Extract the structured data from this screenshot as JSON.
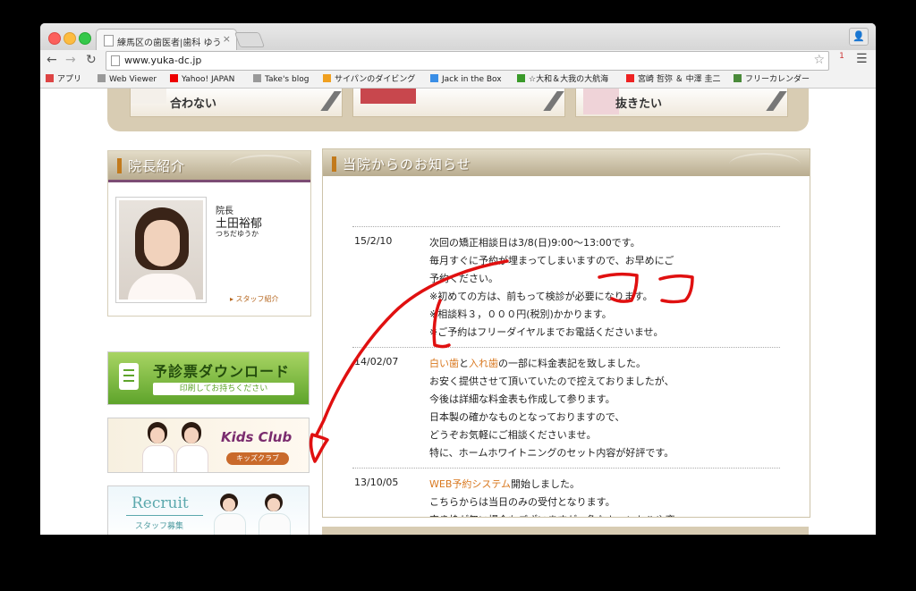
{
  "browser": {
    "tab_title": "練馬区の歯医者|歯科 ゆうか歯科",
    "tab_close": "×",
    "url": "www.yuka-dc.jp",
    "ext_badge": "1",
    "bookmarks": [
      {
        "label": "アプリ",
        "icon": "apps-grid-icon",
        "color": "#d44"
      },
      {
        "label": "Web Viewer",
        "icon": "page-icon",
        "color": "#999"
      },
      {
        "label": "Yahoo! JAPAN",
        "icon": "yahoo-icon",
        "color": "#e00"
      },
      {
        "label": "Take's blog",
        "icon": "page-icon",
        "color": "#999"
      },
      {
        "label": "サイパンのダイビング",
        "icon": "star-logo-icon",
        "color": "#f0a020"
      },
      {
        "label": "Jack in the Box",
        "icon": "jib-icon",
        "color": "#3a8ee6"
      },
      {
        "label": "☆大和＆大我の大航海",
        "icon": "leaf-icon",
        "color": "#3a9a2a"
      },
      {
        "label": "宮崎 哲弥 ＆ 中澤 圭二",
        "icon": "youtube-icon",
        "color": "#e22"
      },
      {
        "label": "フリーカレンダー",
        "icon": "leaf-icon",
        "color": "#4a8a3a"
      }
    ]
  },
  "top_banner": {
    "cards": [
      "合わない",
      "",
      "抜きたい"
    ]
  },
  "director": {
    "heading": "院長紹介",
    "title": "院長",
    "name": "土田裕郁",
    "kana": "つちだゆうか",
    "staff_link": "▸ スタッフ紹介"
  },
  "banners": {
    "download": {
      "title": "予診票ダウンロード",
      "sub": "印刷してお持ちください"
    },
    "kids": {
      "title": "Kids Club",
      "sub": "キッズクラブ"
    },
    "recruit": {
      "title": "Recruit",
      "sub": "スタッフ募集"
    }
  },
  "news": {
    "heading": "当院からのお知らせ",
    "items": [
      {
        "date": "15/2/10",
        "lines": [
          [
            {
              "t": "次回の矯正相談日は3/8(日)9:00〜13:00です。"
            }
          ],
          [
            {
              "t": "毎月すぐに予約が埋まってしまいますので、お早めにご"
            }
          ],
          [
            {
              "t": "予約ください。"
            }
          ],
          [
            {
              "t": "※初めての方は、前もって検診が必要になります。"
            }
          ],
          [
            {
              "t": "※相談料３，０００円(税別)かかります。"
            }
          ],
          [
            {
              "t": "※ご予約はフリーダイヤルまでお電話くださいませ。"
            }
          ]
        ]
      },
      {
        "date": "14/02/07",
        "lines": [
          [
            {
              "t": "白い歯",
              "hl": true
            },
            {
              "t": "と"
            },
            {
              "t": "入れ歯",
              "hl": true
            },
            {
              "t": "の一部に料金表記を致しました。"
            }
          ],
          [
            {
              "t": "お安く提供させて頂いていたので控えておりましたが、"
            }
          ],
          [
            {
              "t": "今後は詳細な料金表も作成して参ります。"
            }
          ],
          [
            {
              "t": "日本製の確かなものとなっておりますので、"
            }
          ],
          [
            {
              "t": "どうぞお気軽にご相談くださいませ。"
            }
          ],
          [
            {
              "t": "特に、ホームホワイトニングのセット内容が好評です。"
            }
          ]
        ]
      },
      {
        "date": "13/10/05",
        "lines": [
          [
            {
              "t": "WEB予約システム",
              "hl": true
            },
            {
              "t": "開始しました。"
            }
          ],
          [
            {
              "t": "こちらからは当日のみの受付となります。"
            }
          ],
          [
            {
              "t": "空き枠が無い場合もございますが、急なキャンセルや変"
            }
          ]
        ]
      }
    ]
  },
  "colors": {
    "accent_orange": "#d9781f",
    "panel_header": "#b9ac8f",
    "scribble_red": "#e01010"
  }
}
